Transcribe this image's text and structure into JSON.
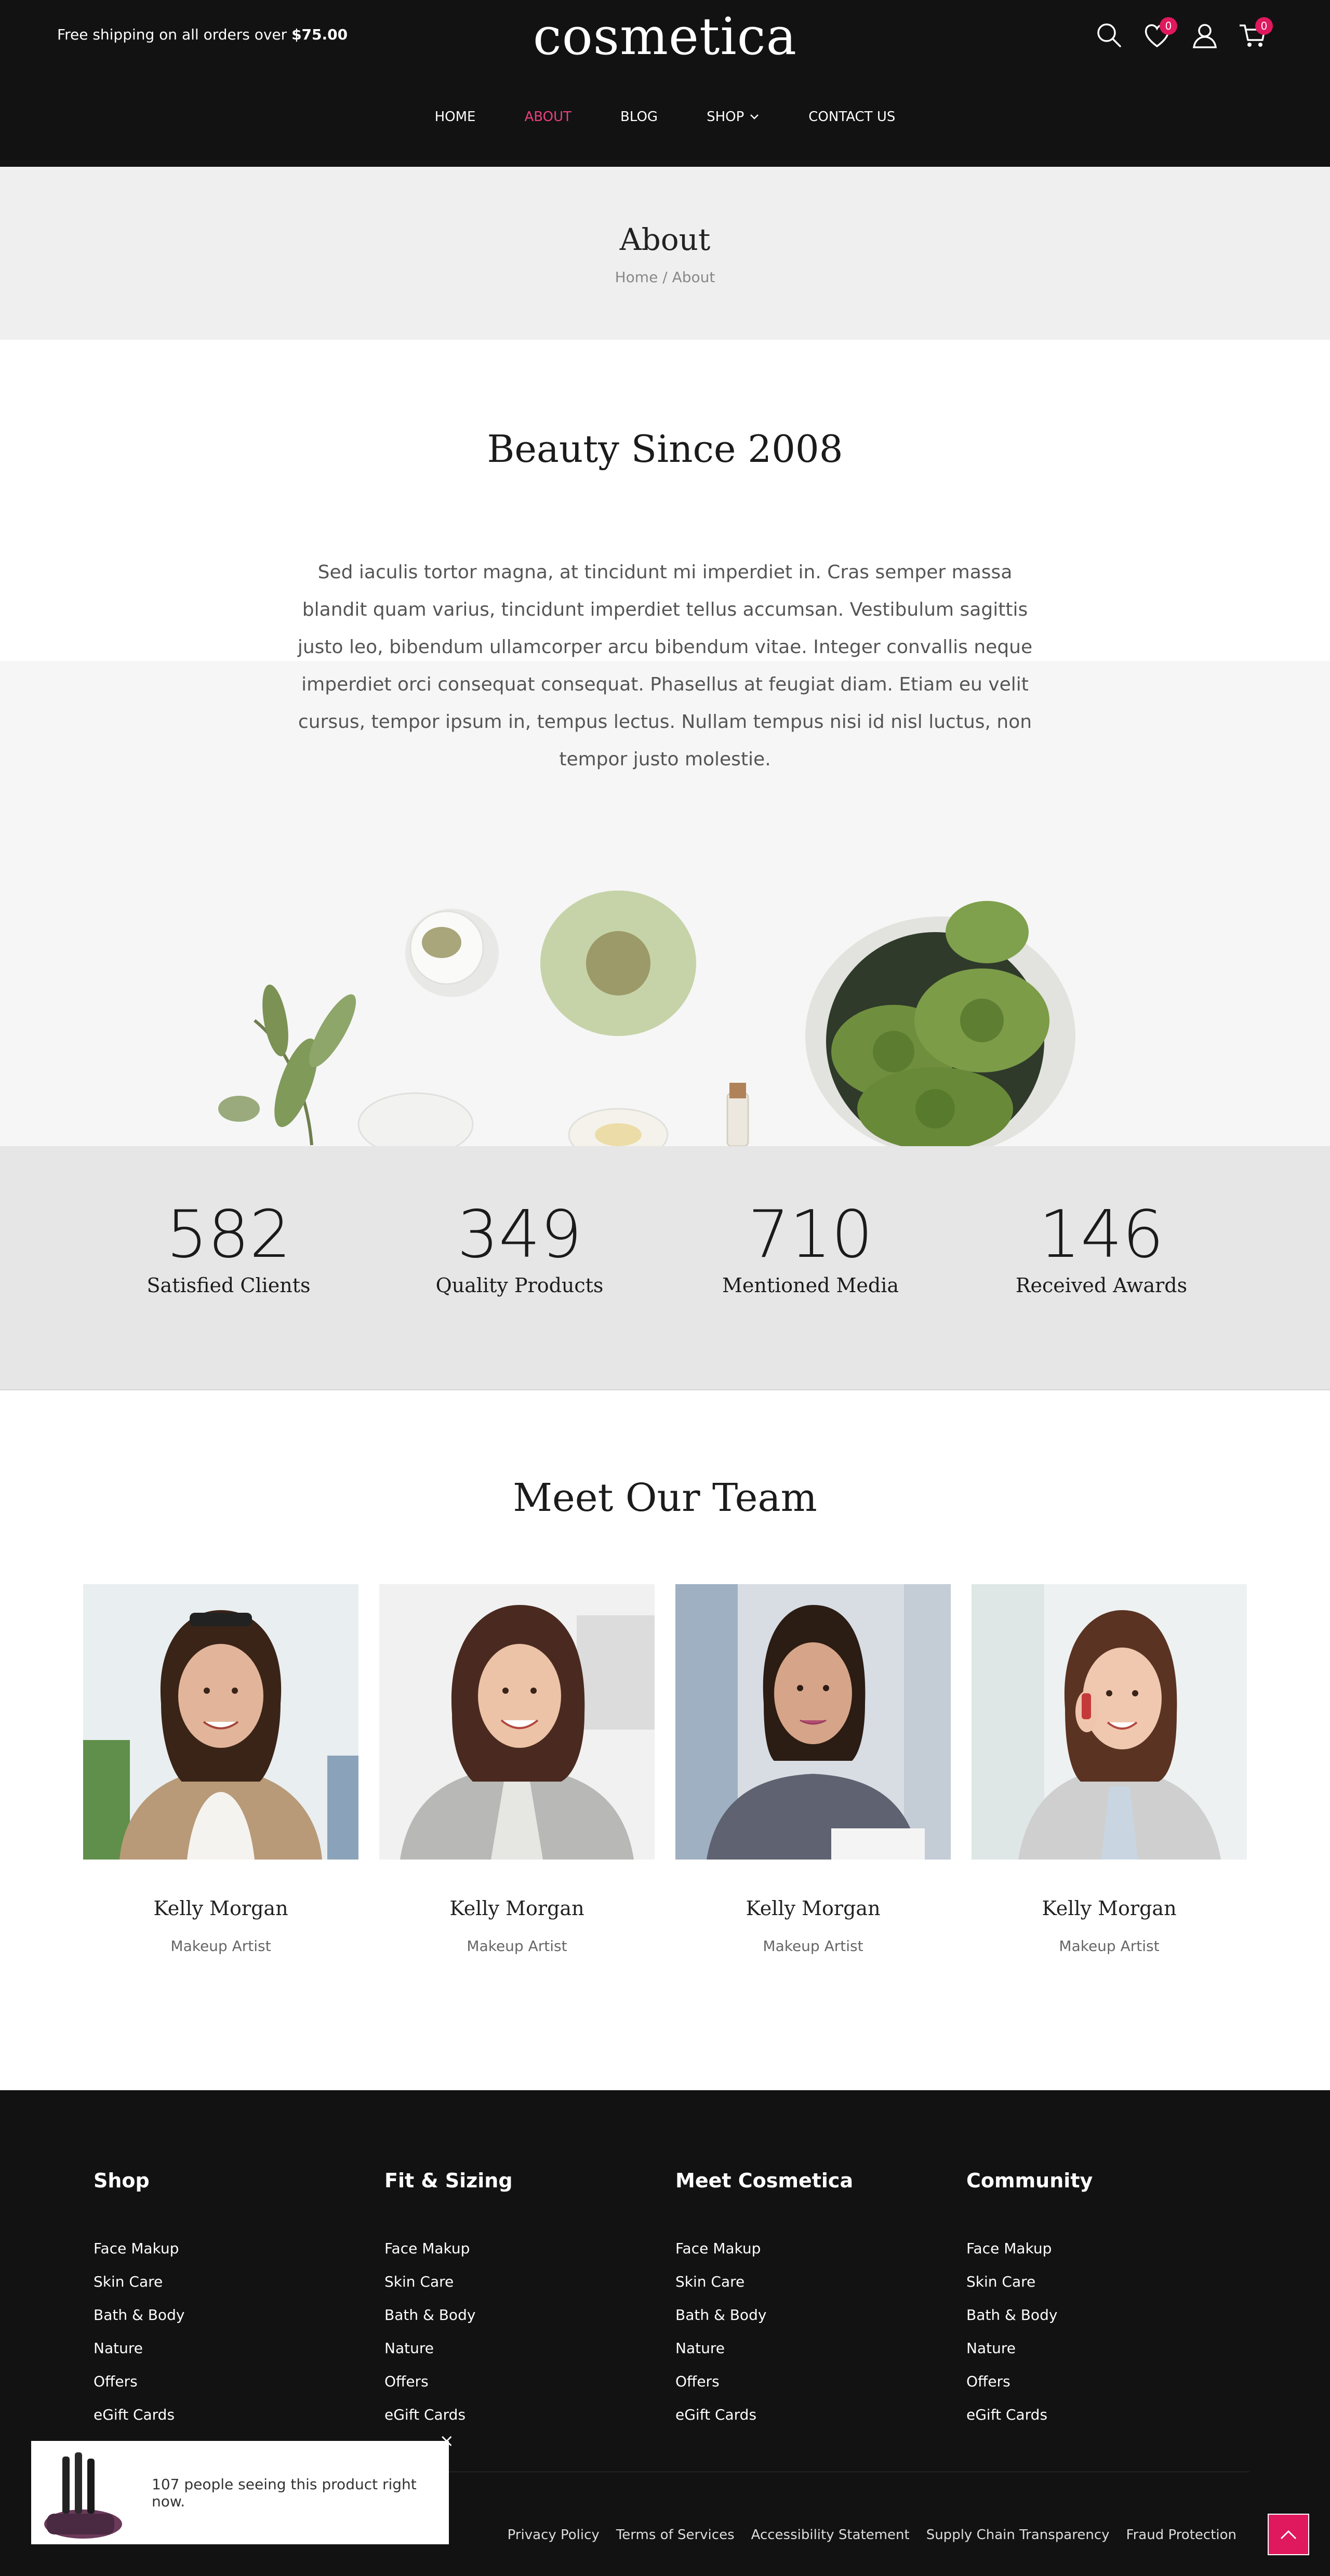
{
  "header": {
    "shipping_text": "Free shipping on all orders over",
    "shipping_amount": "$75.00",
    "logo": "cosmetica",
    "wishlist_count": "0",
    "cart_count": "0",
    "icons": [
      "search-icon",
      "heart-icon",
      "user-icon",
      "cart-icon"
    ],
    "accent_color": "#e0185e"
  },
  "nav": {
    "items": [
      {
        "label": "HOME",
        "active": false
      },
      {
        "label": "ABOUT",
        "active": true
      },
      {
        "label": "BLOG",
        "active": false
      },
      {
        "label": "SHOP",
        "active": false
      },
      {
        "label": "CONTACT US",
        "active": false
      }
    ]
  },
  "page": {
    "title": "About",
    "breadcrumb": [
      "Home",
      "About"
    ],
    "breadcrumb_separator": "/"
  },
  "intro": {
    "heading": "Beauty Since 2008",
    "body": "Sed iaculis tortor magna, at tincidunt mi imperdiet in. Cras semper massa blandit quam varius, tincidunt imperdiet tellus accumsan. Vestibulum sagittis justo leo, bibendum ullamcorper arcu bibendum vitae. Integer convallis neque imperdiet orci consequat consequat. Phasellus at feugiat diam. Etiam eu velit cursus, tempor ipsum in, tempus lectus. Nullam tempus nisi id nisl luctus, non tempor justo molestie."
  },
  "stats": [
    {
      "number": "582",
      "label": "Satisfied Clients"
    },
    {
      "number": "349",
      "label": "Quality Products"
    },
    {
      "number": "710",
      "label": "Mentioned Media"
    },
    {
      "number": "146",
      "label": "Received Awards"
    }
  ],
  "team": {
    "heading": "Meet Our Team",
    "members": [
      {
        "name": "Kelly Morgan",
        "role": "Makeup Artist"
      },
      {
        "name": "Kelly Morgan",
        "role": "Makeup Artist"
      },
      {
        "name": "Kelly Morgan",
        "role": "Makeup Artist"
      },
      {
        "name": "Kelly Morgan",
        "role": "Makeup Artist"
      }
    ]
  },
  "footer": {
    "columns": [
      {
        "title": "Shop",
        "links": [
          "Face Makup",
          "Skin Care",
          "Bath & Body",
          "Nature",
          "Offers",
          "eGift Cards"
        ]
      },
      {
        "title": "Fit & Sizing",
        "links": [
          "Face Makup",
          "Skin Care",
          "Bath & Body",
          "Nature",
          "Offers",
          "eGift Cards"
        ]
      },
      {
        "title": "Meet Cosmetica",
        "links": [
          "Face Makup",
          "Skin Care",
          "Bath & Body",
          "Nature",
          "Offers",
          "eGift Cards"
        ]
      },
      {
        "title": "Community",
        "links": [
          "Face Makup",
          "Skin Care",
          "Bath & Body",
          "Nature",
          "Offers",
          "eGift Cards"
        ]
      }
    ],
    "bottom_links": [
      "Privacy Policy",
      "Terms of Services",
      "Accessibility Statement",
      "Supply Chain Transparency",
      "Fraud Protection"
    ]
  },
  "popup": {
    "text": "107 people seeing this product right now.",
    "close": "×"
  }
}
